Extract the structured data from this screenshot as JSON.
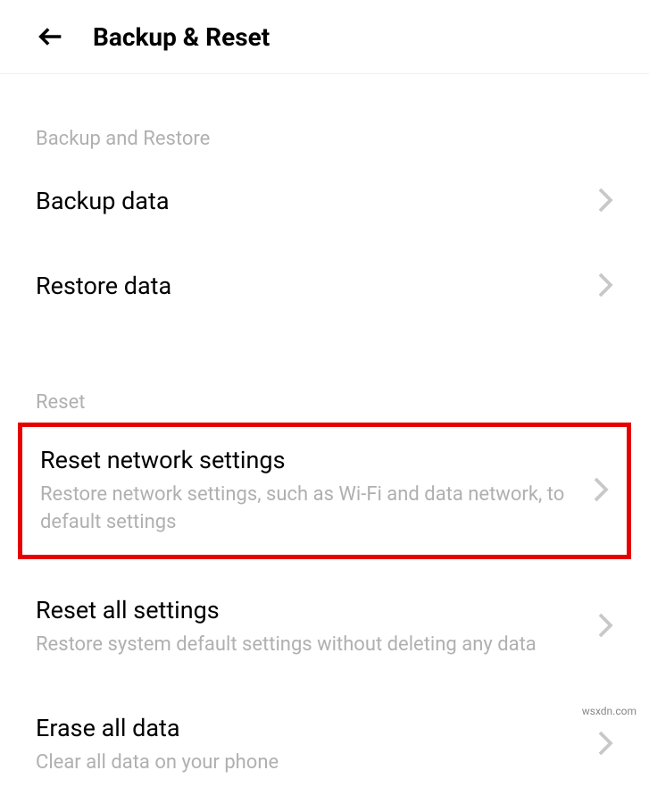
{
  "header": {
    "title": "Backup & Reset"
  },
  "sections": {
    "backup": {
      "label": "Backup and Restore",
      "items": {
        "backup_data": {
          "title": "Backup data"
        },
        "restore_data": {
          "title": "Restore data"
        }
      }
    },
    "reset": {
      "label": "Reset",
      "items": {
        "reset_network": {
          "title": "Reset network settings",
          "subtitle": "Restore network settings, such as Wi-Fi and data network, to default settings"
        },
        "reset_all": {
          "title": "Reset all settings",
          "subtitle": "Restore system default settings without deleting any data"
        },
        "erase_all": {
          "title": "Erase all data",
          "subtitle": "Clear all data on your phone"
        }
      }
    }
  },
  "watermark": "wsxdn.com"
}
